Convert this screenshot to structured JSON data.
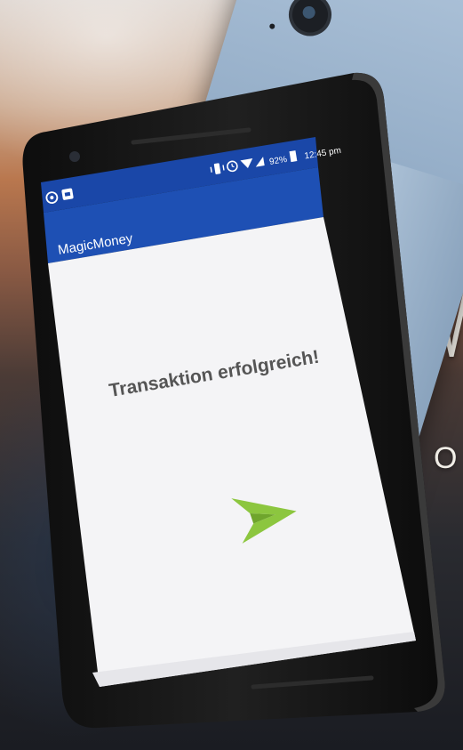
{
  "app": {
    "title": "MagicMoney"
  },
  "status_bar": {
    "battery_percent": "92%",
    "time": "12:45 pm",
    "left_icons": [
      "whatsapp-icon",
      "notification-icon"
    ],
    "right_icons": [
      "vibrate-icon",
      "alarm-icon",
      "wifi-icon",
      "signal-icon",
      "battery-icon"
    ]
  },
  "main": {
    "message": "Transaktion erfolgreich!",
    "icon": "send-arrow-icon"
  },
  "background": {
    "headline_letter": "M",
    "sub_letter": "O"
  },
  "colors": {
    "app_bar": "#1e50b4",
    "status_bar": "#1a47a8",
    "screen_bg": "#f4f4f6",
    "message_text": "#555555",
    "accent_green": "#8cc63f",
    "phone_frame": "#151515",
    "back_phone": "#9bb3cc"
  }
}
